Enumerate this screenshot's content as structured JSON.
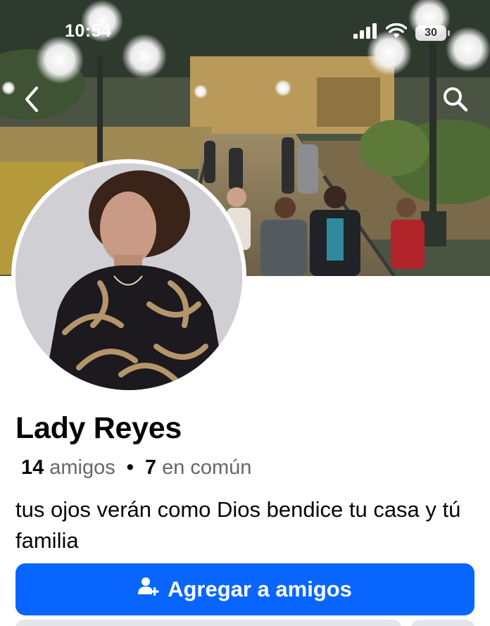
{
  "status_bar": {
    "time": "10:54",
    "battery_level": "30",
    "icons": [
      "signal-icon",
      "wifi-icon",
      "battery-icon"
    ]
  },
  "nav": {
    "back_icon": "chevron-left-icon",
    "search_icon": "search-icon"
  },
  "profile": {
    "name": "Lady Reyes",
    "friends_count": "14",
    "friends_label": "amigos",
    "mutual_count": "7",
    "mutual_label": "en común",
    "separator": "•",
    "bio": "tus ojos verán como Dios bendice tu casa y tú familia"
  },
  "actions": {
    "add_friend_label": "Agregar a amigos",
    "add_friend_icon": "add-person-icon"
  },
  "colors": {
    "accent": "#0866ff",
    "text_primary": "#050505",
    "text_secondary": "#65676b"
  }
}
